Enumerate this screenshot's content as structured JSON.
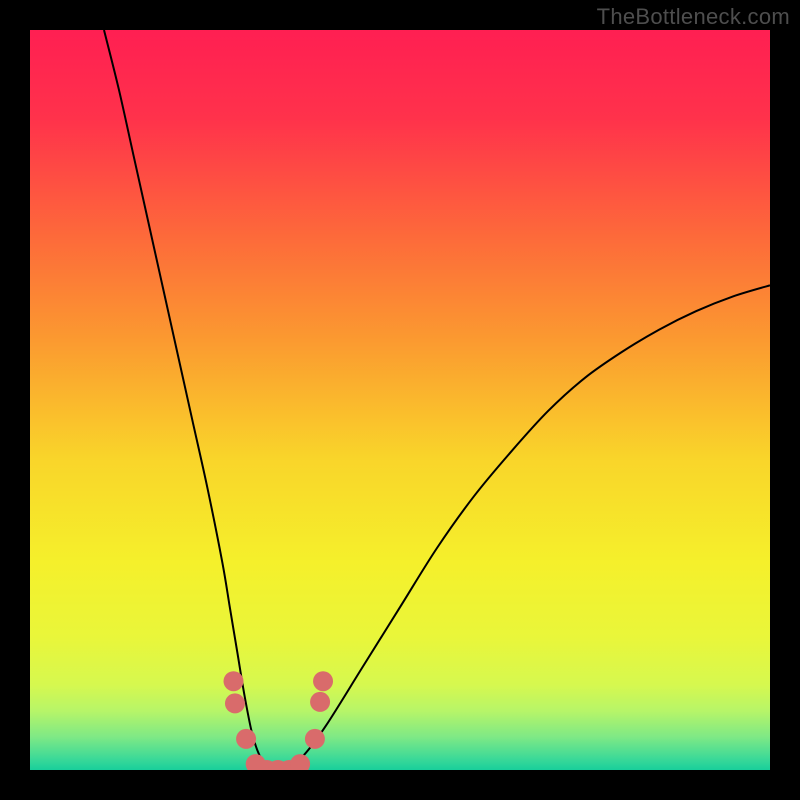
{
  "watermark": "TheBottleneck.com",
  "colors": {
    "page_bg": "#000000",
    "gradient_stops": [
      {
        "offset": 0.0,
        "color": "#ff1f52"
      },
      {
        "offset": 0.12,
        "color": "#ff324b"
      },
      {
        "offset": 0.28,
        "color": "#fd6a3a"
      },
      {
        "offset": 0.42,
        "color": "#fb9a30"
      },
      {
        "offset": 0.58,
        "color": "#f9d52a"
      },
      {
        "offset": 0.72,
        "color": "#f5f02b"
      },
      {
        "offset": 0.82,
        "color": "#e9f63a"
      },
      {
        "offset": 0.885,
        "color": "#d6f84f"
      },
      {
        "offset": 0.92,
        "color": "#b7f568"
      },
      {
        "offset": 0.955,
        "color": "#7fe985"
      },
      {
        "offset": 0.985,
        "color": "#3bd998"
      },
      {
        "offset": 1.0,
        "color": "#18cf9b"
      }
    ],
    "curve_stroke": "#000000",
    "marker_fill": "#d96b6b",
    "marker_stroke": "#c95b5b"
  },
  "chart_data": {
    "type": "line",
    "title": "",
    "xlabel": "",
    "ylabel": "",
    "xlim": [
      0,
      100
    ],
    "ylim": [
      0,
      100
    ],
    "series": [
      {
        "name": "bottleneck-curve",
        "x": [
          10,
          12,
          14,
          16,
          18,
          20,
          22,
          24,
          26,
          27,
          28,
          29,
          30,
          31,
          32,
          33,
          34,
          35,
          37,
          40,
          45,
          50,
          55,
          60,
          65,
          70,
          75,
          80,
          85,
          90,
          95,
          100
        ],
        "y": [
          100,
          92,
          83,
          74,
          65,
          56,
          47,
          38,
          28,
          22,
          16,
          10,
          5,
          2,
          0.5,
          0,
          0,
          0.5,
          2,
          6,
          14,
          22,
          30,
          37,
          43,
          48.5,
          53,
          56.5,
          59.5,
          62,
          64,
          65.5
        ]
      }
    ],
    "markers": [
      {
        "x": 27.5,
        "y": 12.0
      },
      {
        "x": 27.7,
        "y": 9.0
      },
      {
        "x": 29.2,
        "y": 4.2
      },
      {
        "x": 30.5,
        "y": 0.8
      },
      {
        "x": 32.0,
        "y": 0.0
      },
      {
        "x": 33.5,
        "y": 0.0
      },
      {
        "x": 35.0,
        "y": 0.0
      },
      {
        "x": 36.5,
        "y": 0.8
      },
      {
        "x": 38.5,
        "y": 4.2
      },
      {
        "x": 39.2,
        "y": 9.2
      },
      {
        "x": 39.6,
        "y": 12.0
      }
    ]
  }
}
